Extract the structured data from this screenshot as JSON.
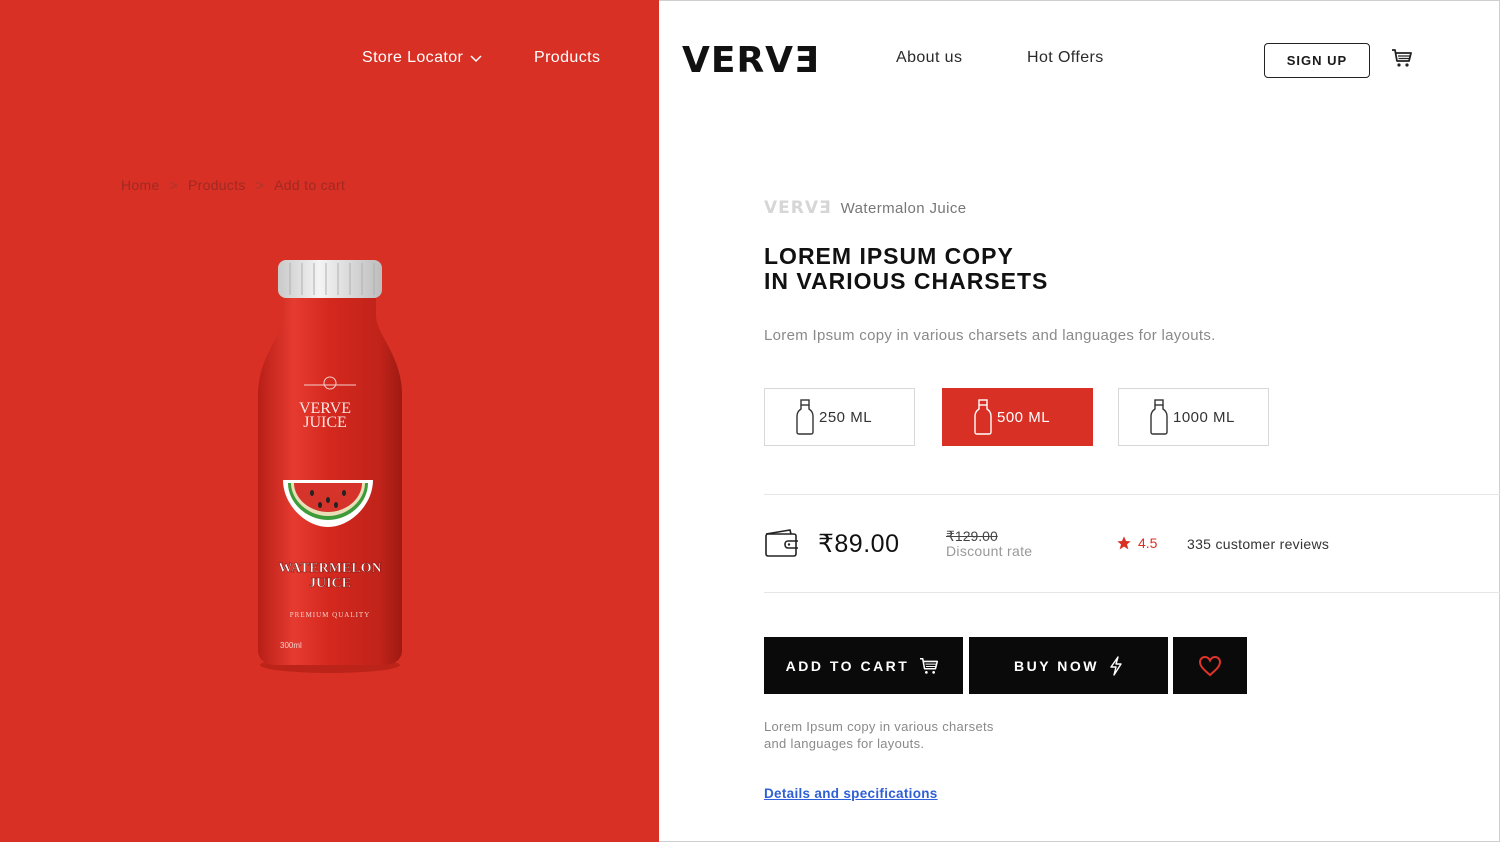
{
  "nav": {
    "store_locator": "Store Locator",
    "products": "Products",
    "about_us": "About us",
    "hot_offers": "Hot Offers",
    "sign_up": "SIGN UP",
    "cart_icon": "cart-icon"
  },
  "logo": {
    "text": "VERVƎ"
  },
  "breadcrumb": {
    "items": [
      "Home",
      "Products",
      "Add to cart"
    ],
    "separator": ">"
  },
  "product_image": {
    "brand_line1": "VERVE",
    "brand_line2": "JUICE",
    "label_line1": "WATERMELON",
    "label_line2": "JUICE",
    "quality": "PREMIUM QUALITY",
    "volume": "300ml"
  },
  "product": {
    "brand_mini": "VERVƎ",
    "name": "Watermalon Juice",
    "title_line1": "LOREM IPSUM COPY",
    "title_line2": "IN VARIOUS CHARSETS",
    "description": "Lorem Ipsum copy in various charsets and languages for layouts."
  },
  "sizes": [
    {
      "label": "250 ML",
      "selected": false
    },
    {
      "label": "500 ML",
      "selected": true
    },
    {
      "label": "1000 ML",
      "selected": false
    }
  ],
  "pricing": {
    "price": "₹89.00",
    "old_price": "₹129.00",
    "discount_label": "Discount rate",
    "rating": "4.5",
    "reviews": "335 customer reviews"
  },
  "actions": {
    "add_to_cart": "ADD TO CART",
    "buy_now": "BUY NOW"
  },
  "note": {
    "line1": "Lorem Ipsum copy in various charsets",
    "line2": "and languages for layouts."
  },
  "details_link": "Details and specifications",
  "colors": {
    "accent": "#d93025",
    "dark": "#0a0a0a",
    "link": "#2f5fd6"
  }
}
